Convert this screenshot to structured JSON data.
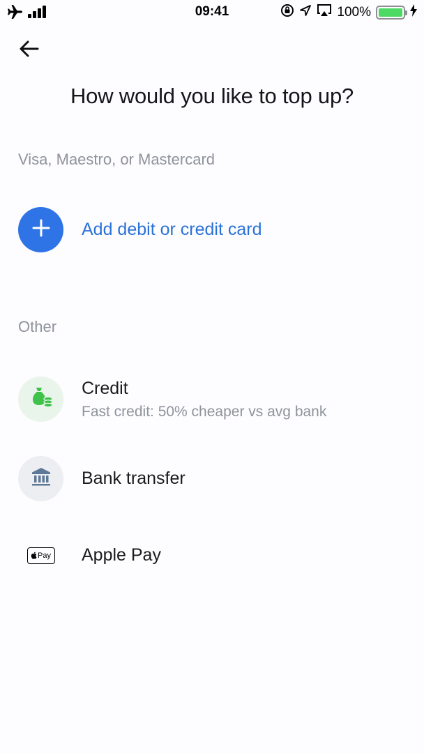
{
  "status_bar": {
    "time": "09:41",
    "battery_percent": "100%",
    "battery_level": 1.0,
    "icons": [
      "airplane-icon",
      "signal-icon",
      "orientation-lock-icon",
      "location-icon",
      "airplay-icon",
      "battery-icon",
      "charging-icon"
    ]
  },
  "header": {
    "back_icon": "arrow-left-icon",
    "title": "How would you like to top up?"
  },
  "cards_section": {
    "label": "Visa, Maestro, or Mastercard",
    "add_card": {
      "icon": "plus-icon",
      "label": "Add debit or credit card"
    }
  },
  "other_section": {
    "label": "Other",
    "options": [
      {
        "icon": "money-bag-coins-icon",
        "title": "Credit",
        "subtitle": "Fast credit: 50% cheaper vs avg bank"
      },
      {
        "icon": "bank-icon",
        "title": "Bank transfer"
      },
      {
        "icon": "apple-pay-icon",
        "title": "Apple Pay",
        "mark_text": "Pay"
      }
    ]
  },
  "colors": {
    "accent": "#2f74e6",
    "link": "#2a72d8",
    "credit_icon_bg": "#e9f5ea",
    "credit_icon": "#3fc14a",
    "bank_icon_bg": "#edeef2",
    "bank_icon": "#5e7897",
    "battery": "#4cd964",
    "muted_text": "#8f939c"
  }
}
